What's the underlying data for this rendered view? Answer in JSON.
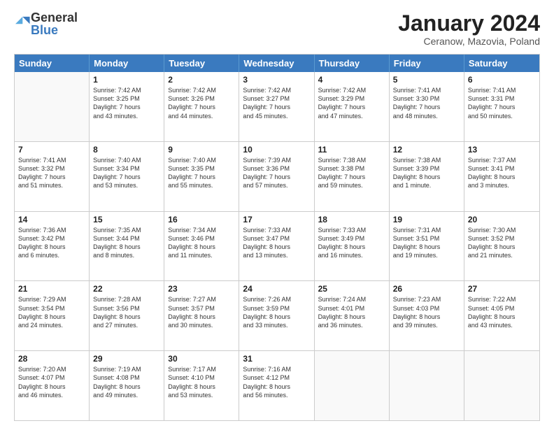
{
  "header": {
    "logo": {
      "general": "General",
      "blue": "Blue"
    },
    "title": "January 2024",
    "subtitle": "Ceranow, Mazovia, Poland"
  },
  "days": [
    "Sunday",
    "Monday",
    "Tuesday",
    "Wednesday",
    "Thursday",
    "Friday",
    "Saturday"
  ],
  "weeks": [
    [
      {
        "day": "",
        "empty": true,
        "lines": []
      },
      {
        "day": "1",
        "lines": [
          "Sunrise: 7:42 AM",
          "Sunset: 3:25 PM",
          "Daylight: 7 hours",
          "and 43 minutes."
        ]
      },
      {
        "day": "2",
        "lines": [
          "Sunrise: 7:42 AM",
          "Sunset: 3:26 PM",
          "Daylight: 7 hours",
          "and 44 minutes."
        ]
      },
      {
        "day": "3",
        "lines": [
          "Sunrise: 7:42 AM",
          "Sunset: 3:27 PM",
          "Daylight: 7 hours",
          "and 45 minutes."
        ]
      },
      {
        "day": "4",
        "lines": [
          "Sunrise: 7:42 AM",
          "Sunset: 3:29 PM",
          "Daylight: 7 hours",
          "and 47 minutes."
        ]
      },
      {
        "day": "5",
        "lines": [
          "Sunrise: 7:41 AM",
          "Sunset: 3:30 PM",
          "Daylight: 7 hours",
          "and 48 minutes."
        ]
      },
      {
        "day": "6",
        "lines": [
          "Sunrise: 7:41 AM",
          "Sunset: 3:31 PM",
          "Daylight: 7 hours",
          "and 50 minutes."
        ]
      }
    ],
    [
      {
        "day": "7",
        "lines": [
          "Sunrise: 7:41 AM",
          "Sunset: 3:32 PM",
          "Daylight: 7 hours",
          "and 51 minutes."
        ]
      },
      {
        "day": "8",
        "lines": [
          "Sunrise: 7:40 AM",
          "Sunset: 3:34 PM",
          "Daylight: 7 hours",
          "and 53 minutes."
        ]
      },
      {
        "day": "9",
        "lines": [
          "Sunrise: 7:40 AM",
          "Sunset: 3:35 PM",
          "Daylight: 7 hours",
          "and 55 minutes."
        ]
      },
      {
        "day": "10",
        "lines": [
          "Sunrise: 7:39 AM",
          "Sunset: 3:36 PM",
          "Daylight: 7 hours",
          "and 57 minutes."
        ]
      },
      {
        "day": "11",
        "lines": [
          "Sunrise: 7:38 AM",
          "Sunset: 3:38 PM",
          "Daylight: 7 hours",
          "and 59 minutes."
        ]
      },
      {
        "day": "12",
        "lines": [
          "Sunrise: 7:38 AM",
          "Sunset: 3:39 PM",
          "Daylight: 8 hours",
          "and 1 minute."
        ]
      },
      {
        "day": "13",
        "lines": [
          "Sunrise: 7:37 AM",
          "Sunset: 3:41 PM",
          "Daylight: 8 hours",
          "and 3 minutes."
        ]
      }
    ],
    [
      {
        "day": "14",
        "lines": [
          "Sunrise: 7:36 AM",
          "Sunset: 3:42 PM",
          "Daylight: 8 hours",
          "and 6 minutes."
        ]
      },
      {
        "day": "15",
        "lines": [
          "Sunrise: 7:35 AM",
          "Sunset: 3:44 PM",
          "Daylight: 8 hours",
          "and 8 minutes."
        ]
      },
      {
        "day": "16",
        "lines": [
          "Sunrise: 7:34 AM",
          "Sunset: 3:46 PM",
          "Daylight: 8 hours",
          "and 11 minutes."
        ]
      },
      {
        "day": "17",
        "lines": [
          "Sunrise: 7:33 AM",
          "Sunset: 3:47 PM",
          "Daylight: 8 hours",
          "and 13 minutes."
        ]
      },
      {
        "day": "18",
        "lines": [
          "Sunrise: 7:33 AM",
          "Sunset: 3:49 PM",
          "Daylight: 8 hours",
          "and 16 minutes."
        ]
      },
      {
        "day": "19",
        "lines": [
          "Sunrise: 7:31 AM",
          "Sunset: 3:51 PM",
          "Daylight: 8 hours",
          "and 19 minutes."
        ]
      },
      {
        "day": "20",
        "lines": [
          "Sunrise: 7:30 AM",
          "Sunset: 3:52 PM",
          "Daylight: 8 hours",
          "and 21 minutes."
        ]
      }
    ],
    [
      {
        "day": "21",
        "lines": [
          "Sunrise: 7:29 AM",
          "Sunset: 3:54 PM",
          "Daylight: 8 hours",
          "and 24 minutes."
        ]
      },
      {
        "day": "22",
        "lines": [
          "Sunrise: 7:28 AM",
          "Sunset: 3:56 PM",
          "Daylight: 8 hours",
          "and 27 minutes."
        ]
      },
      {
        "day": "23",
        "lines": [
          "Sunrise: 7:27 AM",
          "Sunset: 3:57 PM",
          "Daylight: 8 hours",
          "and 30 minutes."
        ]
      },
      {
        "day": "24",
        "lines": [
          "Sunrise: 7:26 AM",
          "Sunset: 3:59 PM",
          "Daylight: 8 hours",
          "and 33 minutes."
        ]
      },
      {
        "day": "25",
        "lines": [
          "Sunrise: 7:24 AM",
          "Sunset: 4:01 PM",
          "Daylight: 8 hours",
          "and 36 minutes."
        ]
      },
      {
        "day": "26",
        "lines": [
          "Sunrise: 7:23 AM",
          "Sunset: 4:03 PM",
          "Daylight: 8 hours",
          "and 39 minutes."
        ]
      },
      {
        "day": "27",
        "lines": [
          "Sunrise: 7:22 AM",
          "Sunset: 4:05 PM",
          "Daylight: 8 hours",
          "and 43 minutes."
        ]
      }
    ],
    [
      {
        "day": "28",
        "lines": [
          "Sunrise: 7:20 AM",
          "Sunset: 4:07 PM",
          "Daylight: 8 hours",
          "and 46 minutes."
        ]
      },
      {
        "day": "29",
        "lines": [
          "Sunrise: 7:19 AM",
          "Sunset: 4:08 PM",
          "Daylight: 8 hours",
          "and 49 minutes."
        ]
      },
      {
        "day": "30",
        "lines": [
          "Sunrise: 7:17 AM",
          "Sunset: 4:10 PM",
          "Daylight: 8 hours",
          "and 53 minutes."
        ]
      },
      {
        "day": "31",
        "lines": [
          "Sunrise: 7:16 AM",
          "Sunset: 4:12 PM",
          "Daylight: 8 hours",
          "and 56 minutes."
        ]
      },
      {
        "day": "",
        "empty": true,
        "lines": []
      },
      {
        "day": "",
        "empty": true,
        "lines": []
      },
      {
        "day": "",
        "empty": true,
        "lines": []
      }
    ]
  ]
}
